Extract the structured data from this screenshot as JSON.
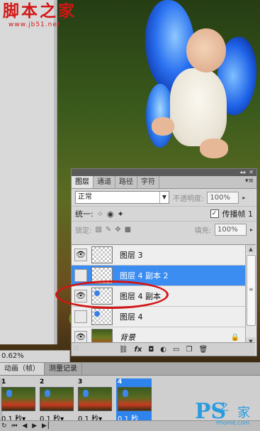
{
  "watermark": {
    "title": "脚本之家",
    "url": "www.jb51.net"
  },
  "zoom_level": "0.62%",
  "layers_panel": {
    "tabs": [
      {
        "label": "图层",
        "active": true
      },
      {
        "label": "通道",
        "active": false
      },
      {
        "label": "路径",
        "active": false
      },
      {
        "label": "字符",
        "active": false
      }
    ],
    "blend_mode": "正常",
    "opacity_label": "不透明度:",
    "opacity_value": "100%",
    "unify_label": "统一:",
    "propagate_label": "传播帧 1",
    "propagate_checked": "✓",
    "lock_label": "锁定:",
    "fill_label": "填充:",
    "fill_value": "100%",
    "layers": [
      {
        "name": "图层 3",
        "visible": true,
        "selected": false,
        "thumb": "transparent"
      },
      {
        "name": "图层 4 副本 2",
        "visible": false,
        "selected": true,
        "thumb": "transparent"
      },
      {
        "name": "图层 4 副本",
        "visible": true,
        "selected": false,
        "thumb": "baby"
      },
      {
        "name": "图层 4",
        "visible": false,
        "selected": false,
        "thumb": "baby"
      },
      {
        "name": "背景",
        "visible": true,
        "selected": false,
        "thumb": "photo",
        "locked": true
      }
    ],
    "bottom_icons": [
      "link-icon",
      "fx-icon",
      "mask-icon",
      "adjustment-icon",
      "group-icon",
      "new-layer-icon",
      "delete-icon"
    ]
  },
  "animation_panel": {
    "tabs": [
      {
        "label": "动画（帧）",
        "active": true
      },
      {
        "label": "测量记录",
        "active": false
      }
    ],
    "frames": [
      {
        "number": "1",
        "time": "0.1 秒▾",
        "selected": false
      },
      {
        "number": "2",
        "time": "0.1 秒▾",
        "selected": false
      },
      {
        "number": "3",
        "time": "0.1 秒▾",
        "selected": false
      },
      {
        "number": "4",
        "time": "0.1 秒",
        "selected": true
      }
    ]
  },
  "logo": {
    "ps": "PS",
    "zhi": "之",
    "jia": "家",
    "domain": "Phome.com"
  }
}
